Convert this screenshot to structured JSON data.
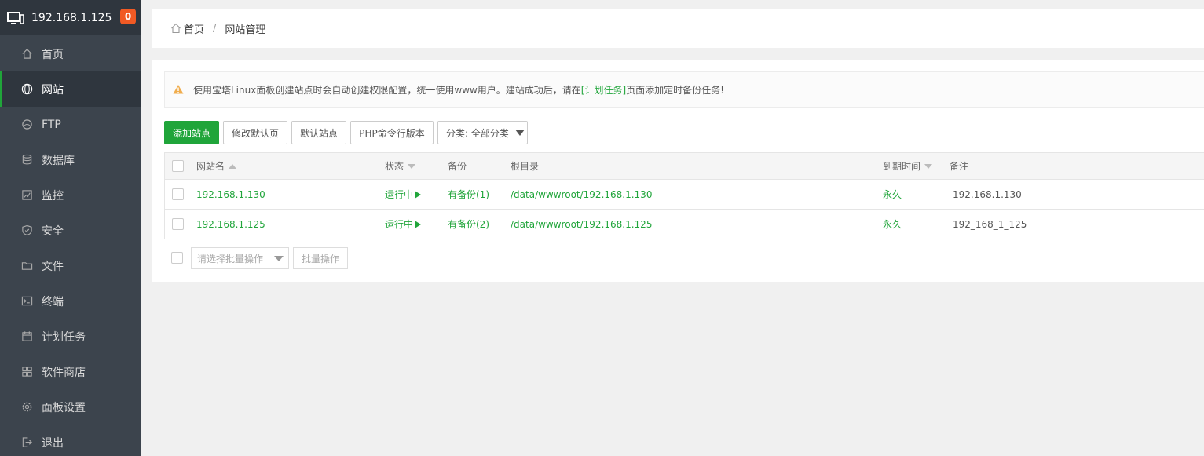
{
  "sidebar": {
    "host": "192.168.1.125",
    "badge": "0",
    "items": [
      {
        "label": "首页",
        "icon": "home-icon"
      },
      {
        "label": "网站",
        "icon": "globe-icon",
        "active": true
      },
      {
        "label": "FTP",
        "icon": "ftp-icon"
      },
      {
        "label": "数据库",
        "icon": "database-icon"
      },
      {
        "label": "监控",
        "icon": "monitor-icon"
      },
      {
        "label": "安全",
        "icon": "shield-icon"
      },
      {
        "label": "文件",
        "icon": "folder-icon"
      },
      {
        "label": "终端",
        "icon": "terminal-icon"
      },
      {
        "label": "计划任务",
        "icon": "calendar-icon"
      },
      {
        "label": "软件商店",
        "icon": "apps-icon"
      },
      {
        "label": "面板设置",
        "icon": "gear-icon"
      },
      {
        "label": "退出",
        "icon": "logout-icon"
      }
    ]
  },
  "breadcrumb": {
    "home": "首页",
    "separator": "/",
    "current": "网站管理"
  },
  "notice": {
    "prefix": "使用宝塔Linux面板创建站点时会自动创建权限配置，统一使用www用户。建站成功后，请在",
    "link": "[计划任务]",
    "suffix": "页面添加定时备份任务!"
  },
  "toolbar": {
    "add_site": "添加站点",
    "edit_default_page": "修改默认页",
    "default_site": "默认站点",
    "php_cli_version": "PHP命令行版本",
    "category": "分类: 全部分类"
  },
  "table": {
    "headers": {
      "name": "网站名",
      "status": "状态",
      "backup": "备份",
      "root": "根目录",
      "expire": "到期时间",
      "remark": "备注"
    },
    "rows": [
      {
        "name": "192.168.1.130",
        "status": "运行中",
        "backup": "有备份(1)",
        "root": "/data/wwwroot/192.168.1.130",
        "expire": "永久",
        "remark": "192.168.1.130"
      },
      {
        "name": "192.168.1.125",
        "status": "运行中",
        "backup": "有备份(2)",
        "root": "/data/wwwroot/192.168.1.125",
        "expire": "永久",
        "remark": "192_168_1_125"
      }
    ]
  },
  "batch": {
    "select_placeholder": "请选择批量操作",
    "button": "批量操作"
  },
  "colors": {
    "accent": "#20a53a",
    "sidebar": "#3c444d",
    "badge": "#f15a24",
    "warning": "#f0ad4e"
  }
}
